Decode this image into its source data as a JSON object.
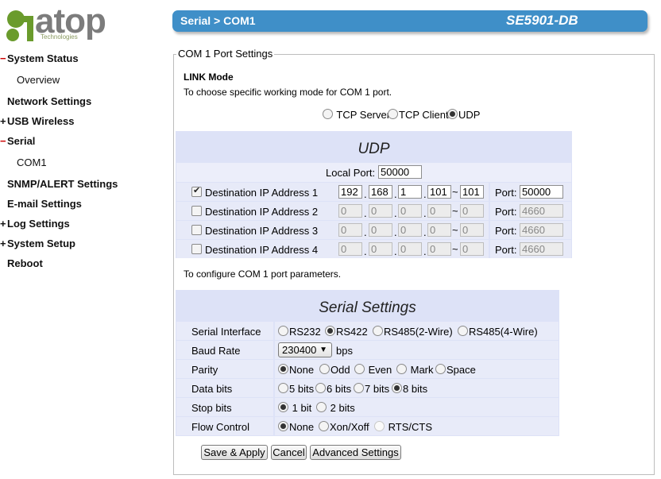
{
  "logo": {
    "text": "atop",
    "sub": "Technologies"
  },
  "sidebar": {
    "items": [
      {
        "label": "System Status",
        "prefix": "−"
      },
      {
        "label": "Overview",
        "prefix": ""
      },
      {
        "label": "Network Settings",
        "prefix": ""
      },
      {
        "label": "USB Wireless",
        "prefix": "+"
      },
      {
        "label": "Serial",
        "prefix": "−"
      },
      {
        "label": "COM1",
        "prefix": ""
      },
      {
        "label": "SNMP/ALERT Settings",
        "prefix": ""
      },
      {
        "label": "E-mail Settings",
        "prefix": ""
      },
      {
        "label": "Log Settings",
        "prefix": "+"
      },
      {
        "label": "System Setup",
        "prefix": "+"
      },
      {
        "label": "Reboot",
        "prefix": ""
      }
    ]
  },
  "header": {
    "breadcrumb": "Serial > COM1",
    "model": "SE5901-DB"
  },
  "section": {
    "legend": "COM 1 Port Settings",
    "link_mode_title": "LINK Mode",
    "link_mode_desc": "To choose specific working mode for COM 1 port.",
    "modes": [
      "TCP Server",
      "TCP Client",
      "UDP"
    ],
    "mode_selected": "UDP"
  },
  "udp": {
    "title": "UDP",
    "local_port_label": "Local Port:",
    "local_port": "50000",
    "port_label": "Port:",
    "destinations": [
      {
        "label": "Destination IP Address 1",
        "checked": true,
        "ip": [
          "192",
          "168",
          "1",
          "101"
        ],
        "end": "101",
        "port": "50000"
      },
      {
        "label": "Destination IP Address 2",
        "checked": false,
        "ip": [
          "0",
          "0",
          "0",
          "0"
        ],
        "end": "0",
        "port": "4660"
      },
      {
        "label": "Destination IP Address 3",
        "checked": false,
        "ip": [
          "0",
          "0",
          "0",
          "0"
        ],
        "end": "0",
        "port": "4660"
      },
      {
        "label": "Destination IP Address 4",
        "checked": false,
        "ip": [
          "0",
          "0",
          "0",
          "0"
        ],
        "end": "0",
        "port": "4660"
      }
    ]
  },
  "configure_text": "To configure COM 1 port parameters.",
  "serial": {
    "title": "Serial Settings",
    "interface_label": "Serial Interface",
    "interfaces": [
      "RS232",
      "RS422",
      "RS485(2-Wire)",
      "RS485(4-Wire)"
    ],
    "interface_selected": "RS422",
    "baud_label": "Baud Rate",
    "baud_value": "230400",
    "baud_unit": "bps",
    "parity_label": "Parity",
    "parities": [
      "None",
      "Odd",
      "Even",
      "Mark",
      "Space"
    ],
    "parity_selected": "None",
    "databits_label": "Data bits",
    "databits": [
      "5 bits",
      "6 bits",
      "7 bits",
      "8 bits"
    ],
    "databits_selected": "8 bits",
    "stopbits_label": "Stop bits",
    "stopbits": [
      "1 bit",
      "2 bits"
    ],
    "stopbits_selected": "1 bit",
    "flow_label": "Flow Control",
    "flows": [
      "None",
      "Xon/Xoff",
      "RTS/CTS"
    ],
    "flow_selected": "None"
  },
  "buttons": {
    "save": "Save & Apply",
    "cancel": "Cancel",
    "advanced": "Advanced Settings"
  },
  "colors": {
    "header": "#3f8fc8",
    "panel": "#dde2f7",
    "row": "#e8ebf9",
    "logo_green": "#6a9b2c"
  }
}
